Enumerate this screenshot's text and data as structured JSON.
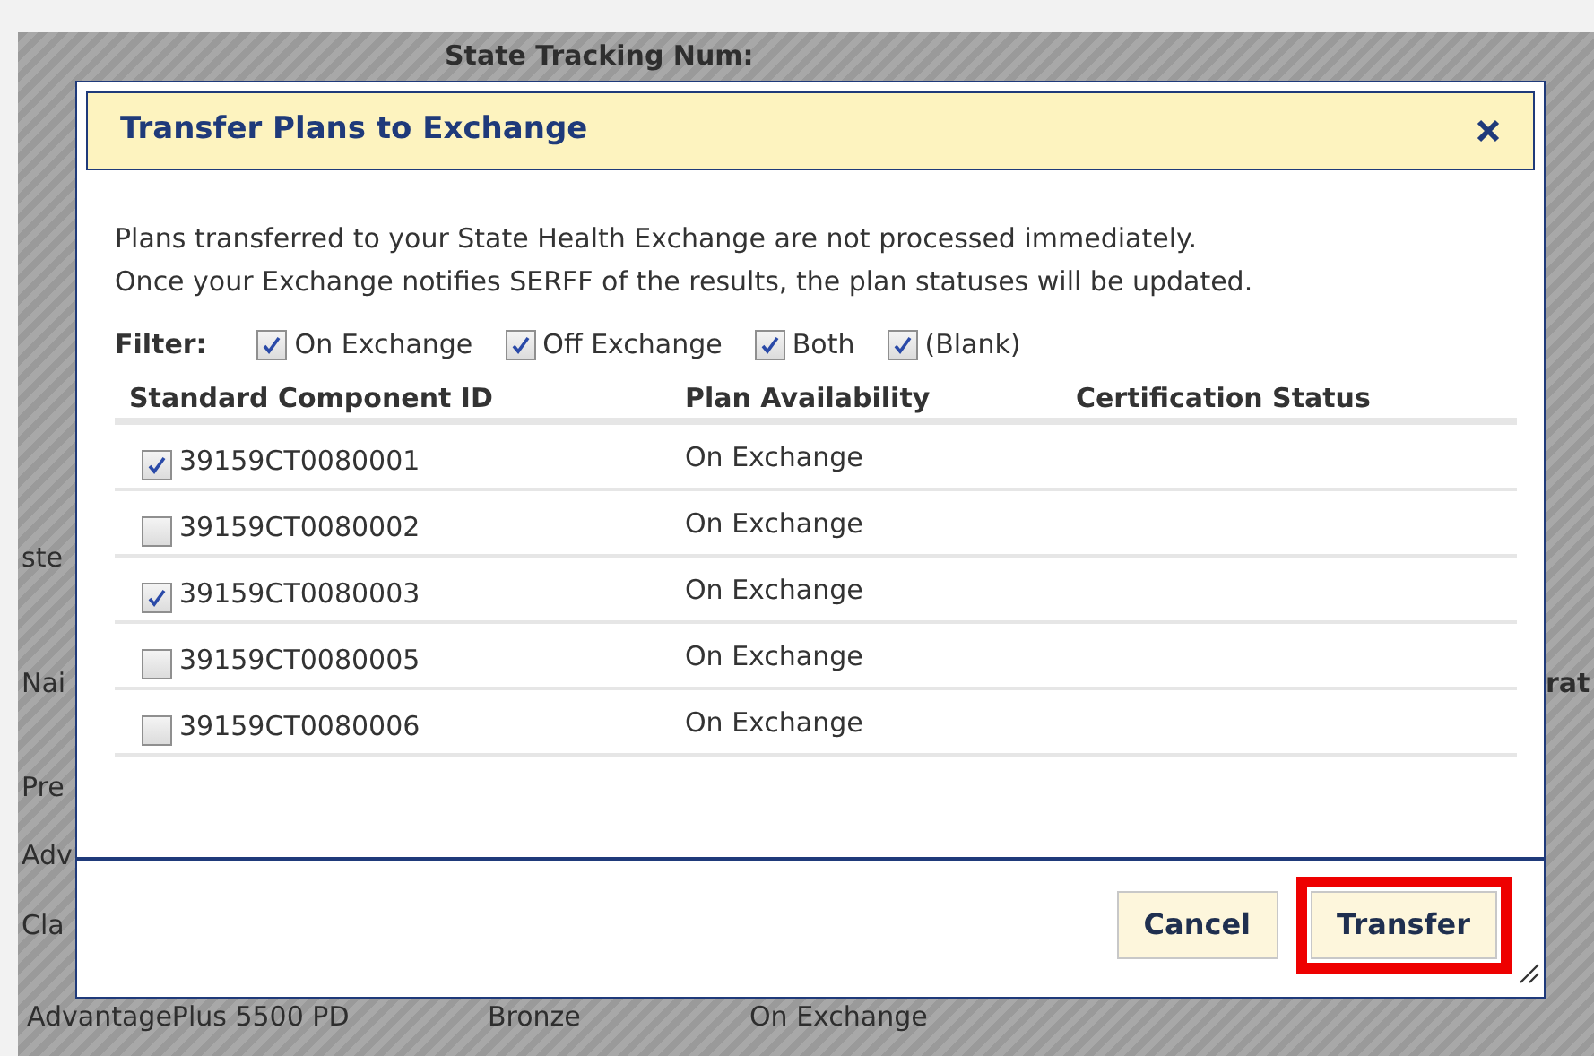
{
  "background": {
    "tracking_label": "State Tracking Num:",
    "left_fragments": [
      "ste",
      "Nai",
      "Pre",
      "Adv",
      "Cla"
    ],
    "right_fragment": "rat",
    "bottom_row": [
      "AdvantagePlus 5500 PD",
      "Bronze",
      "On Exchange"
    ]
  },
  "dialog": {
    "title": "Transfer Plans to Exchange",
    "message": [
      "Plans transferred to your State Health Exchange are not processed immediately.",
      "Once your Exchange notifies SERFF of the results, the plan statuses will be updated."
    ],
    "filter_label": "Filter:",
    "filters": [
      {
        "label": "On Exchange",
        "checked": true
      },
      {
        "label": "Off Exchange",
        "checked": true
      },
      {
        "label": "Both",
        "checked": true
      },
      {
        "label": "(Blank)",
        "checked": true
      }
    ],
    "columns": [
      "Standard Component ID",
      "Plan Availability",
      "Certification Status"
    ],
    "rows": [
      {
        "id": "39159CT0080001",
        "availability": "On Exchange",
        "checked": true
      },
      {
        "id": "39159CT0080002",
        "availability": "On Exchange",
        "checked": false
      },
      {
        "id": "39159CT0080003",
        "availability": "On Exchange",
        "checked": true
      },
      {
        "id": "39159CT0080005",
        "availability": "On Exchange",
        "checked": false
      },
      {
        "id": "39159CT0080006",
        "availability": "On Exchange",
        "checked": false
      }
    ],
    "buttons": [
      {
        "label": "Cancel",
        "highlighted": false
      },
      {
        "label": "Transfer",
        "highlighted": true
      }
    ]
  }
}
